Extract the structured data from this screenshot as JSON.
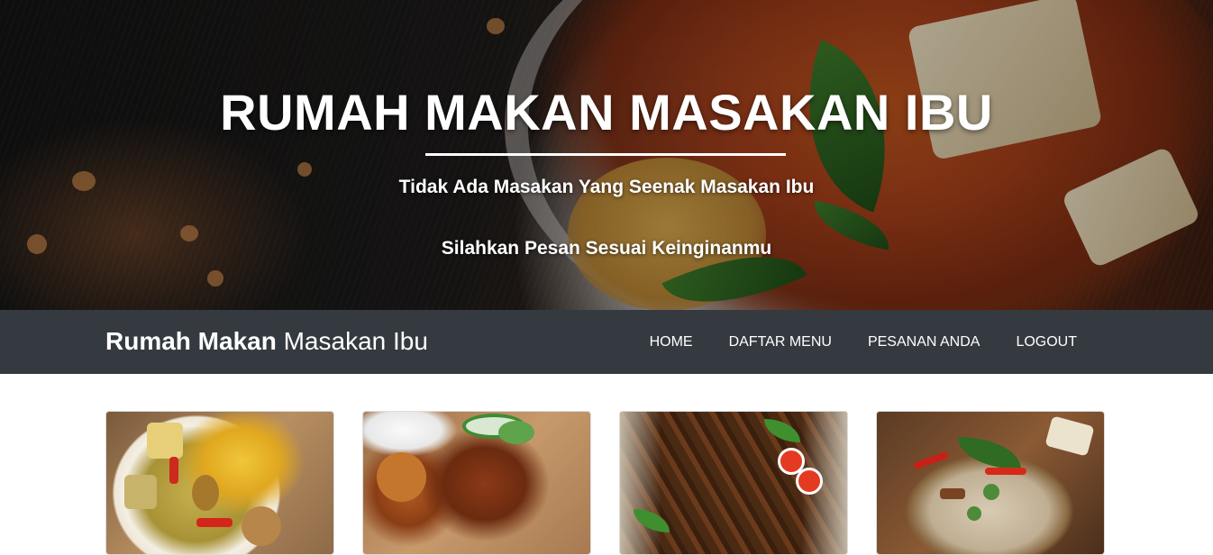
{
  "hero": {
    "title": "RUMAH MAKAN MASAKAN IBU",
    "subtitle_1": "Tidak Ada Masakan Yang Seenak Masakan Ibu",
    "subtitle_2": "Silahkan Pesan Sesuai Keinginanmu"
  },
  "navbar": {
    "brand_bold": "Rumah Makan",
    "brand_light": "Masakan Ibu",
    "links": [
      {
        "label": "HOME"
      },
      {
        "label": "DAFTAR MENU"
      },
      {
        "label": "PESANAN ANDA"
      },
      {
        "label": "LOGOUT"
      }
    ]
  },
  "menu_cards": [
    {
      "image": "vegetable-soup-photo"
    },
    {
      "image": "fried-chicken-photo"
    },
    {
      "image": "grilled-fish-photo"
    },
    {
      "image": "rice-dish-photo"
    }
  ],
  "colors": {
    "navbar_bg": "#343a40",
    "text_light": "#ffffff"
  }
}
